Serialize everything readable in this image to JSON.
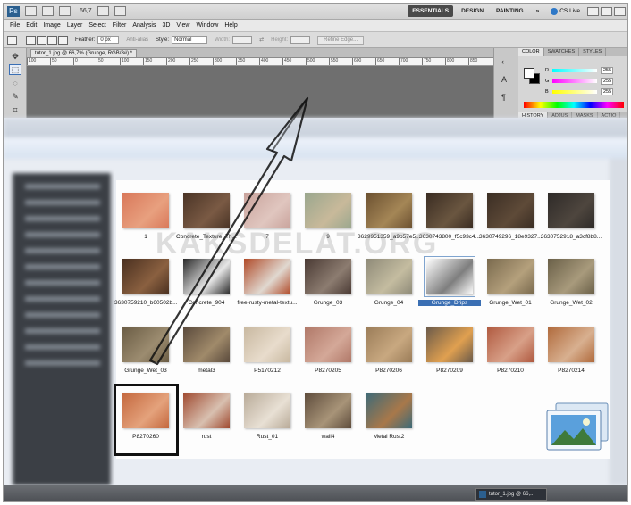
{
  "photoshop": {
    "logo": "Ps",
    "zoom": "66,7",
    "workspaces": [
      "ESSENTIALS",
      "DESIGN",
      "PAINTING"
    ],
    "more": "»",
    "cs_live": "CS Live",
    "menu": [
      "File",
      "Edit",
      "Image",
      "Layer",
      "Select",
      "Filter",
      "Analysis",
      "3D",
      "View",
      "Window",
      "Help"
    ],
    "options": {
      "feather_label": "Feather:",
      "feather_value": "0 px",
      "antialias_label": "Anti-alias",
      "style_label": "Style:",
      "style_value": "Normal",
      "width_label": "Width:",
      "height_label": "Height:",
      "refine_edge": "Refine Edge..."
    },
    "document_tab": "tutor_1.jpg @ 66,7% (Grunge, RGB/8#) *",
    "ruler_ticks": [
      "100",
      "50",
      "0",
      "50",
      "100",
      "150",
      "200",
      "250",
      "300",
      "350",
      "400",
      "450",
      "500",
      "550",
      "600",
      "650",
      "700",
      "750",
      "800",
      "850"
    ],
    "panels": {
      "color_tabs": [
        "COLOR",
        "SWATCHES",
        "STYLES"
      ],
      "channels": [
        {
          "name": "R",
          "value": "255",
          "gradient": "linear-gradient(90deg,#00ffff,#ffffff)"
        },
        {
          "name": "G",
          "value": "255",
          "gradient": "linear-gradient(90deg,#ff00ff,#ffffff)"
        },
        {
          "name": "B",
          "value": "255",
          "gradient": "linear-gradient(90deg,#ffff00,#ffffff)"
        }
      ],
      "history_tabs": [
        "HISTORY",
        "ADJUS",
        "MASKS",
        "ACTIO"
      ]
    }
  },
  "explorer": {
    "watermark": "KAKSDELAT.ORG",
    "thumbnails": [
      {
        "label": "1",
        "c1": "#d9785a",
        "c2": "#e8a07f"
      },
      {
        "label": "Concrete_Texture_Th...",
        "c1": "#4a3426",
        "c2": "#7a5a44"
      },
      {
        "label": "7",
        "c1": "#c9a39c",
        "c2": "#e0c6bf"
      },
      {
        "label": "9",
        "c1": "#9aa78e",
        "c2": "#c8b99a"
      },
      {
        "label": "3629951359_a9b57e5...",
        "c1": "#6b5030",
        "c2": "#a48656"
      },
      {
        "label": "3630743800_f5c93c4...",
        "c1": "#3a2c22",
        "c2": "#6a5640"
      },
      {
        "label": "3630749296_18e9327...",
        "c1": "#3b2e24",
        "c2": "#5e4a38"
      },
      {
        "label": "3630752918_a3cf8b8...",
        "c1": "#2e2a28",
        "c2": "#4e463e"
      },
      {
        "label": "3630759210_b60502b...",
        "c1": "#4a3020",
        "c2": "#8a6040"
      },
      {
        "label": "Concrete_904",
        "c1": "#2a2a2a",
        "c2": "#e6e6e6"
      },
      {
        "label": "free-rusty-metal-textu...",
        "c1": "#b04a28",
        "c2": "#e0d8d0"
      },
      {
        "label": "Grunge_03",
        "c1": "#4a3a34",
        "c2": "#8c7c70"
      },
      {
        "label": "Grunge_04",
        "c1": "#8e8a78",
        "c2": "#c4bca0"
      },
      {
        "label": "Grunge_Drips",
        "c1": "#ffffff",
        "c2": "#7e7e7e"
      },
      {
        "label": "Grunge_Wet_01",
        "c1": "#7a6a4e",
        "c2": "#b4a07c"
      },
      {
        "label": "Grunge_Wet_02",
        "c1": "#6a6048",
        "c2": "#a89a7c"
      },
      {
        "label": "Grunge_Wet_03",
        "c1": "#6a5c44",
        "c2": "#9c8c70"
      },
      {
        "label": "metal3",
        "c1": "#5a4a3c",
        "c2": "#a08a6a"
      },
      {
        "label": "P5170212",
        "c1": "#c8b8a0",
        "c2": "#e8dccc"
      },
      {
        "label": "P8270205",
        "c1": "#b07868",
        "c2": "#d4a898"
      },
      {
        "label": "P8270206",
        "c1": "#9a7c58",
        "c2": "#c8a880"
      },
      {
        "label": "P8270209",
        "c1": "#6a5a4a",
        "c2": "#e0a050"
      },
      {
        "label": "P8270210",
        "c1": "#b05a40",
        "c2": "#d8a088"
      },
      {
        "label": "P8270214",
        "c1": "#b06a3c",
        "c2": "#d8b090"
      },
      {
        "label": "P8270260",
        "c1": "#c4683e",
        "c2": "#e4a27c"
      },
      {
        "label": "rust",
        "c1": "#a04a30",
        "c2": "#d8c0b0"
      },
      {
        "label": "Rust_01",
        "c1": "#b8aa98",
        "c2": "#e8e0d4"
      },
      {
        "label": "wall4",
        "c1": "#5e4c3c",
        "c2": "#a89478"
      },
      {
        "label": "Metal Rust2",
        "c1": "#3c6a78",
        "c2": "#a8784a"
      }
    ],
    "selected_index": 13,
    "highlighted_index": 24
  },
  "taskbar": {
    "task_label": "tutor_1.jpg @ 66,..."
  }
}
